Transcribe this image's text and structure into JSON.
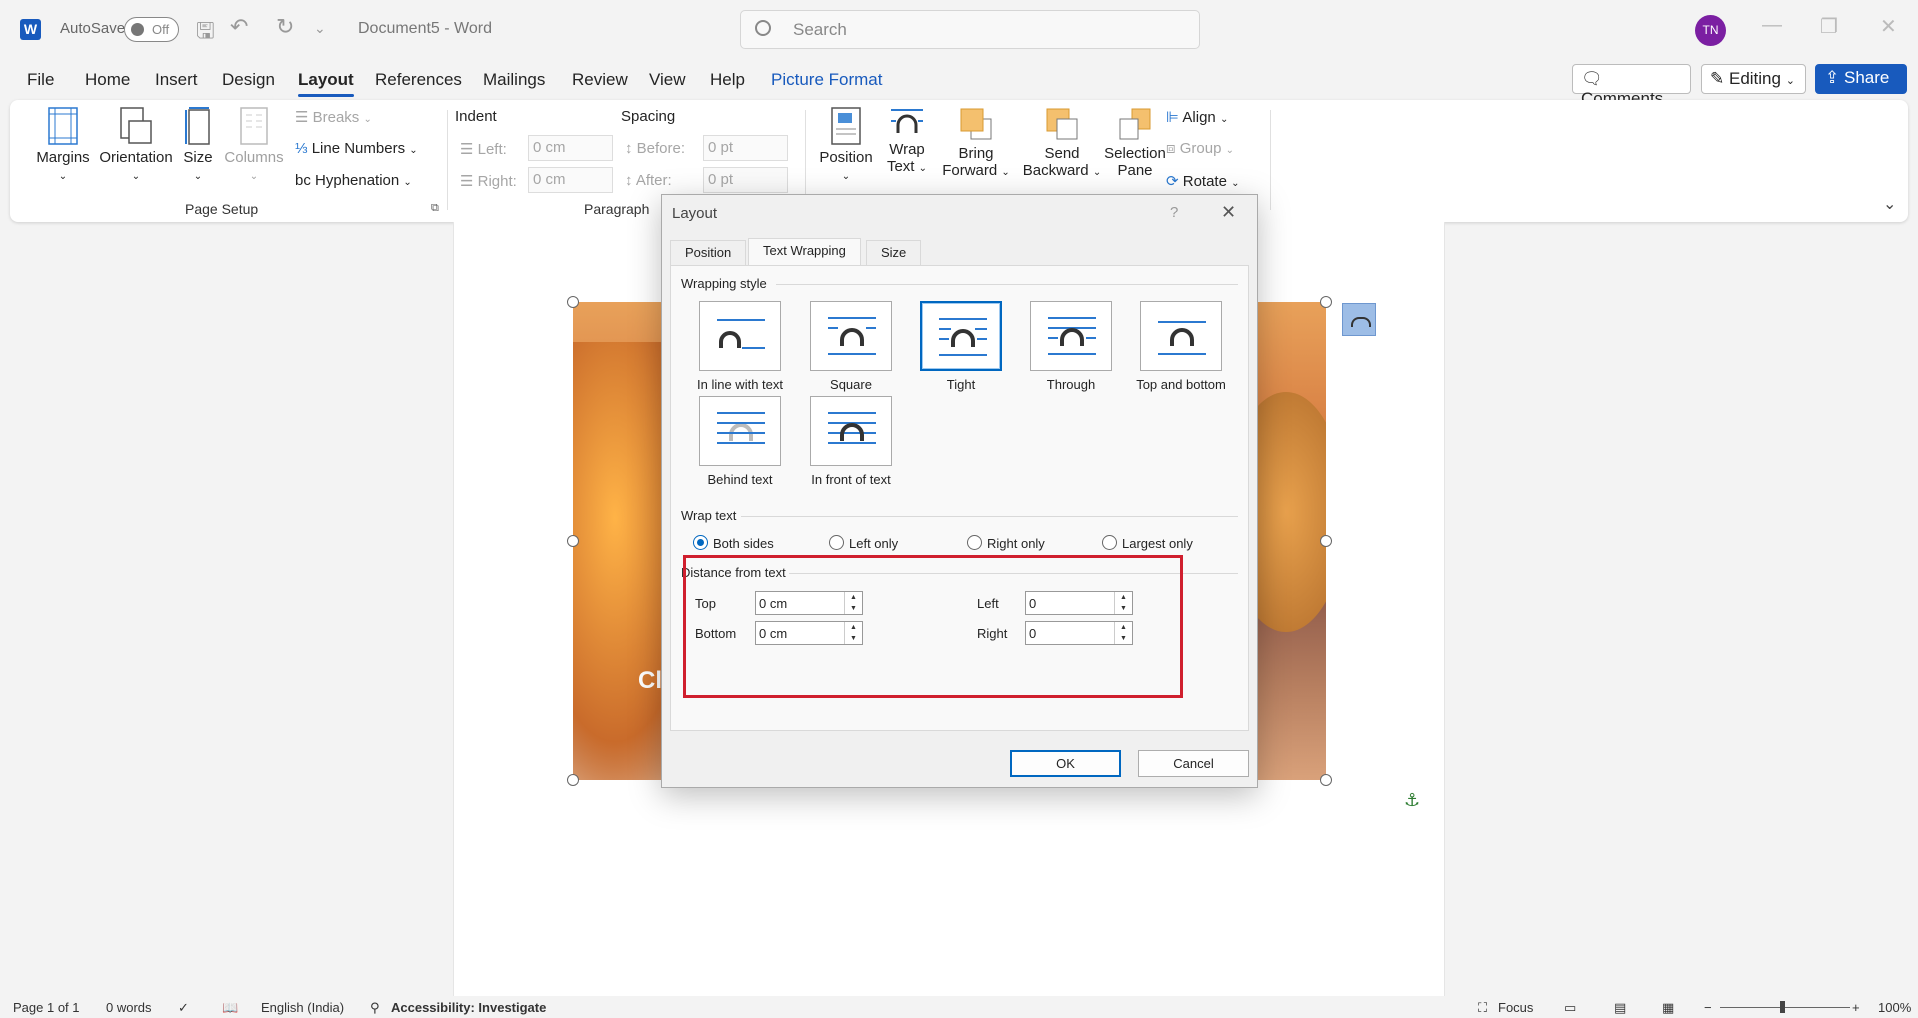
{
  "app": {
    "autosave_label": "AutoSave",
    "autosave_state": "Off",
    "doc_title": "Document5  -  Word",
    "search_placeholder": "Search",
    "user_initials": "TN"
  },
  "menu": {
    "tabs": [
      "File",
      "Home",
      "Insert",
      "Design",
      "Layout",
      "References",
      "Mailings",
      "Review",
      "View",
      "Help",
      "Picture Format"
    ],
    "active": "Layout",
    "comments_label": "Comments",
    "editing_label": "Editing",
    "share_label": "Share"
  },
  "ribbon": {
    "page_setup": {
      "margins": "Margins",
      "orientation": "Orientation",
      "size": "Size",
      "columns": "Columns",
      "breaks": "Breaks",
      "line_numbers": "Line Numbers",
      "hyphenation": "Hyphenation",
      "group_label": "Page Setup"
    },
    "paragraph": {
      "indent_label": "Indent",
      "spacing_label": "Spacing",
      "left_label": "Left:",
      "right_label": "Right:",
      "before_label": "Before:",
      "after_label": "After:",
      "left_val": "0 cm",
      "right_val": "0 cm",
      "before_val": "0 pt",
      "after_val": "0 pt",
      "group_label": "Paragraph"
    },
    "arrange": {
      "position": "Position",
      "wrap_text_1": "Wrap",
      "wrap_text_2": "Text",
      "bring_forward_1": "Bring",
      "bring_forward_2": "Forward",
      "send_backward_1": "Send",
      "send_backward_2": "Backward",
      "selection_pane_1": "Selection",
      "selection_pane_2": "Pane",
      "align": "Align",
      "group": "Group",
      "rotate": "Rotate"
    }
  },
  "picture": {
    "caption_fragment": "Cl"
  },
  "dialog": {
    "title": "Layout",
    "help": "?",
    "close": "✕",
    "tabs": [
      "Position",
      "Text Wrapping",
      "Size"
    ],
    "active_tab": "Text Wrapping",
    "wrapping_style_label": "Wrapping style",
    "styles": [
      "In line with text",
      "Square",
      "Tight",
      "Through",
      "Top and bottom",
      "Behind text",
      "In front of text"
    ],
    "selected_style": "Tight",
    "wrap_text_label": "Wrap text",
    "wrap_options": [
      "Both sides",
      "Left only",
      "Right only",
      "Largest only"
    ],
    "selected_wrap": "Both sides",
    "distance_label": "Distance from text",
    "top_label": "Top",
    "bottom_label": "Bottom",
    "left_label": "Left",
    "right_label": "Right",
    "top_val": "0 cm",
    "bottom_val": "0 cm",
    "left_val": "0",
    "right_val": "0",
    "ok_label": "OK",
    "cancel_label": "Cancel"
  },
  "status": {
    "page": "Page 1 of 1",
    "words": "0 words",
    "language": "English (India)",
    "accessibility": "Accessibility: Investigate",
    "focus": "Focus",
    "zoom": "100%"
  },
  "colors": {
    "accent": "#185abd",
    "highlight": "#d01f2e",
    "selected_border": "#0067c0"
  }
}
